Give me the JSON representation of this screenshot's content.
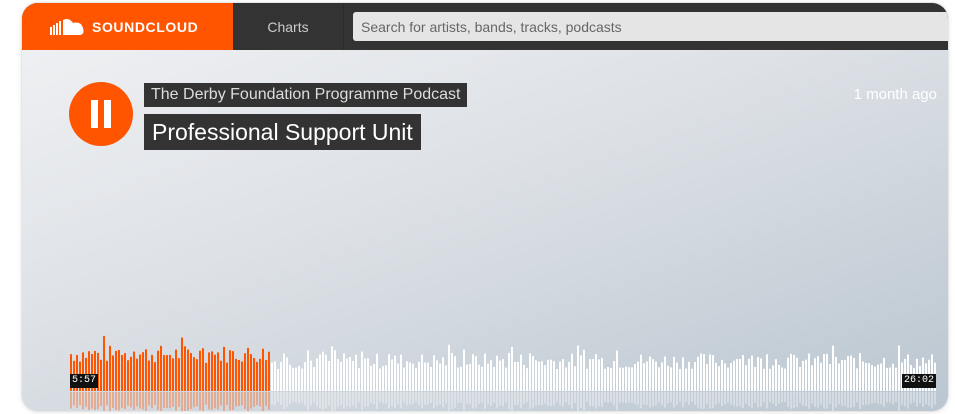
{
  "header": {
    "logo_text": "SOUNDCLOUD",
    "nav_charts": "Charts",
    "search_placeholder": "Search for artists, bands, tracks, podcasts"
  },
  "track": {
    "podcast": "The Derby Foundation Programme Podcast",
    "title": "Professional Support Unit",
    "posted": "1 month ago",
    "state_icon": "pause-icon"
  },
  "player": {
    "current_time": "5:57",
    "duration": "26:02",
    "progress_fraction": 0.229
  },
  "colors": {
    "brand": "#ff5500",
    "header_bg": "#333333",
    "played": "#ff5500",
    "unplayed": "#ffffff"
  }
}
